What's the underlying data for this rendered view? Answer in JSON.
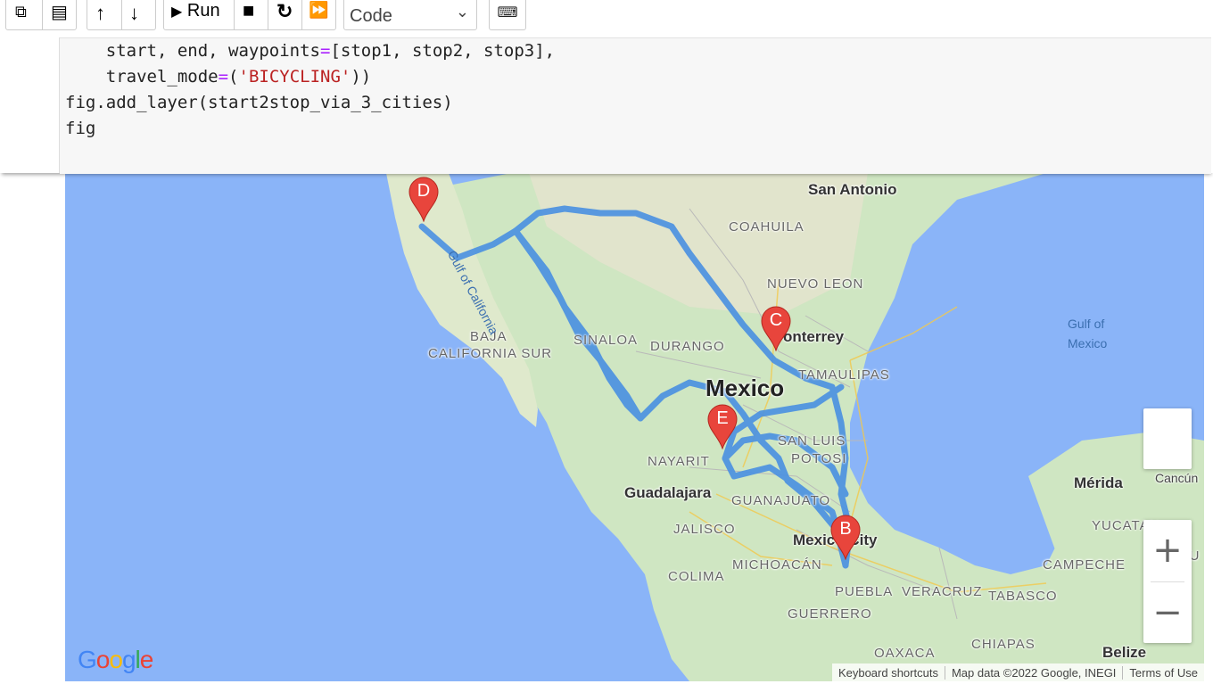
{
  "toolbar": {
    "copy_icon": "copy-icon",
    "paste_icon": "paste-icon",
    "move_up_icon": "arrow-up-icon",
    "move_down_icon": "arrow-down-icon",
    "run_label": "Run",
    "stop_icon": "stop-icon",
    "restart_icon": "restart-icon",
    "run_all_icon": "fast-forward-icon",
    "cell_type": "Code",
    "keyboard_icon": "keyboard-icon"
  },
  "code": {
    "line1_a": "    start, end, waypoints",
    "line1_b": "[stop1, stop2, stop3],",
    "line2_a": "    travel_mode",
    "line2_str": "'BICYCLING'",
    "line2_b": "))",
    "line3": "fig.add_layer(start2stop_via_3_cities)",
    "line4": "fig"
  },
  "map": {
    "country": "Mexico",
    "cities": [
      "San Antonio",
      "onterrey",
      "Guadalajara",
      "Mexico City",
      "Mérida",
      "Cancún",
      "Belize"
    ],
    "states": [
      "COAHUILA",
      "NUEVO LEON",
      "BAJA",
      "CALIFORNIA SUR",
      "SINALOA",
      "DURANGO",
      "TAMAULIPAS",
      "SAN LUIS",
      "POTOSI",
      "NAYARIT",
      "GUANAJUATO",
      "JALISCO",
      "MICHOACÁN",
      "COLIMA",
      "PUEBLA",
      "VERACRUZ",
      "TABASCO",
      "GUERRERO",
      "OAXACA",
      "CHIAPAS",
      "YUCATAN",
      "CAMPECHE",
      "QU"
    ],
    "water": [
      "Gulf of",
      "Mexico",
      "Gulf of California"
    ],
    "markers": [
      "D",
      "C",
      "E",
      "B"
    ],
    "zoom_in": "+",
    "zoom_out": "−",
    "logo": "Google",
    "attribution": [
      "Keyboard shortcuts",
      "Map data ©2022 Google, INEGI",
      "Terms of Use"
    ],
    "colors": {
      "water": "#8ab4f8",
      "land": "#cfe6c2",
      "route": "#4a90e2",
      "marker": "#e8453c"
    }
  }
}
